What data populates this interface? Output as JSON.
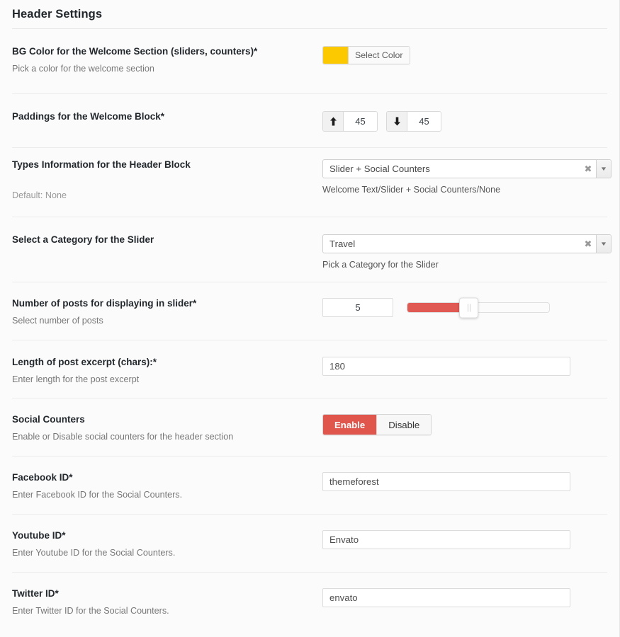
{
  "page": {
    "title": "Header Settings"
  },
  "colors": {
    "swatch": "#fcc800",
    "accent_red": "#e0554c",
    "slider_fill": "#e05a53"
  },
  "rows": {
    "bg_color": {
      "label": "BG Color for the Welcome Section (sliders, counters)*",
      "desc": "Pick a color for the welcome section",
      "button_label": "Select Color",
      "swatch_color": "#fcc800"
    },
    "paddings": {
      "label": "Paddings for the Welcome Block*",
      "top": {
        "icon": "arrow-up-icon",
        "glyph": "⬆",
        "value": "45"
      },
      "bottom": {
        "icon": "arrow-down-icon",
        "glyph": "⬇",
        "value": "45"
      }
    },
    "types_information": {
      "label": "Types Information for the Header Block",
      "desc": "Default: None",
      "selected": "Slider + Social Counters",
      "hint": "Welcome Text/Slider + Social Counters/None",
      "clear_glyph": "✖",
      "arrow_glyph": "▼"
    },
    "category": {
      "label": "Select a Category for the Slider",
      "selected": "Travel",
      "hint": "Pick a Category for the Slider",
      "clear_glyph": "✖",
      "arrow_glyph": "▼"
    },
    "num_posts": {
      "label": "Number of posts for displaying in slider*",
      "desc": "Select number of posts",
      "value": "5",
      "slider_percent": 43
    },
    "excerpt_length": {
      "label": "Length of post excerpt (chars):*",
      "desc": "Enter length for the post excerpt",
      "value": "180"
    },
    "social_counters": {
      "label": "Social Counters",
      "desc": "Enable or Disable social counters for the header section",
      "enable_label": "Enable",
      "disable_label": "Disable",
      "selected": "Enable"
    },
    "facebook": {
      "label": "Facebook ID*",
      "desc": "Enter Facebook ID for the Social Counters.",
      "value": "themeforest"
    },
    "youtube": {
      "label": "Youtube ID*",
      "desc": "Enter Youtube ID for the Social Counters.",
      "value": "Envato"
    },
    "twitter": {
      "label": "Twitter ID*",
      "desc": "Enter Twitter ID for the Social Counters.",
      "value": "envato"
    }
  }
}
